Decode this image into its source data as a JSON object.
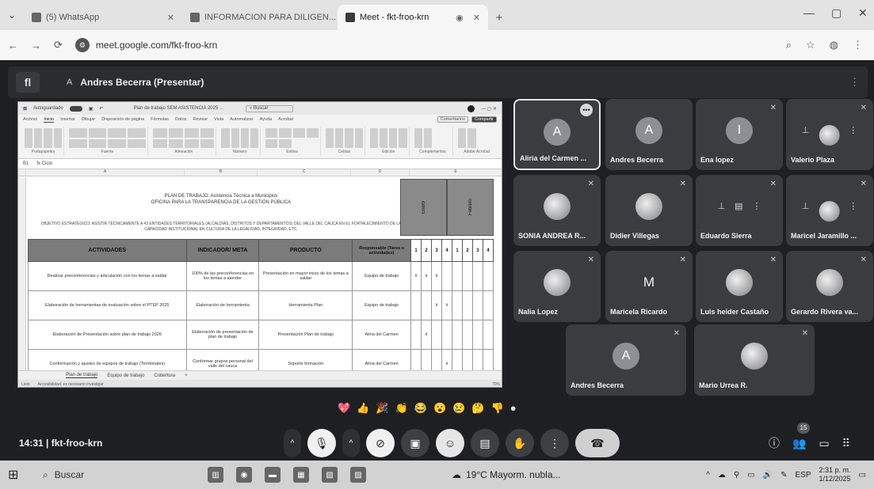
{
  "browser": {
    "tabs": [
      {
        "title": "(5) WhatsApp",
        "active": false
      },
      {
        "title": "INFORMACION PARA DILIGEN...",
        "active": false
      },
      {
        "title": "Meet - fkt-froo-krn",
        "active": true
      }
    ],
    "url": "meet.google.com/fkt-froo-krn",
    "window_controls": [
      "—",
      "▢",
      "✕"
    ]
  },
  "meet": {
    "logo_letter": "fl",
    "presenter_initial": "A",
    "presenter_label": "Andres Becerra (Presentar)",
    "meeting_code": "14:31  |  fkt-froo-krn",
    "participant_count": "15",
    "participants": [
      {
        "name": "Aliria del Carmen ...",
        "initial": "A"
      },
      {
        "name": "Andres Becerra",
        "initial": "A"
      },
      {
        "name": "Ena lopez",
        "initial": "I"
      },
      {
        "name": "Valerio Plaza",
        "initial": ""
      },
      {
        "name": "SONIA ANDREA R...",
        "initial": ""
      },
      {
        "name": "Didier Villegas",
        "initial": ""
      },
      {
        "name": "Eduardo Sierra",
        "initial": ""
      },
      {
        "name": "Maricel Jaramillo ...",
        "initial": ""
      },
      {
        "name": "Nalia Lopez",
        "initial": ""
      },
      {
        "name": "Maricela Ricardo",
        "initial": "M"
      },
      {
        "name": "Luis heider Castaño",
        "initial": ""
      },
      {
        "name": "Gerardo Rivera va...",
        "initial": ""
      },
      {
        "name": "Andres Becerra",
        "initial": "A"
      },
      {
        "name": "Mario Urrea R.",
        "initial": ""
      }
    ],
    "reactions": [
      "💖",
      "👍",
      "🎉",
      "👏",
      "😂",
      "😮",
      "😢",
      "🤔",
      "👎",
      "●"
    ]
  },
  "excel": {
    "autosave": "Autoguardado",
    "file_title": "Plan de trabajo SEM ASISTENCIA 2025 ...",
    "search": "Buscar",
    "menu": [
      "Archivo",
      "Inicio",
      "Insertar",
      "Dibujar",
      "Disposición de página",
      "Fórmulas",
      "Datos",
      "Revisar",
      "Vista",
      "Automatizar",
      "Ayuda",
      "Acrobat"
    ],
    "comments_btn": "Comentarios",
    "share_btn": "Compartir",
    "ribbon_groups": [
      "Portapapeles",
      "Fuente",
      "Alineación",
      "Número",
      "Estilos",
      "Celdas",
      "Edición",
      "Complementos",
      "Adobe Acrobat"
    ],
    "cell_ref": "B1",
    "formula": "fx  Ciclo",
    "columns": [
      "A",
      "B",
      "C",
      "D",
      "E"
    ],
    "plan_title": "PLAN DE TRABAJO: Asistencia Técnica a Municipios",
    "plan_subtitle": "OFICINA PARA LA TRANSPARENCIA DE LA GESTIÓN PÚBLICA",
    "objective": "OBJETIVO ESTRATÉGICO: ASISTIR TÉCNICAMENTE A 43 ENTIDADES TERRITORIALES (ALCALDÍAS, DISTRITOS Y DEPARTAMENTOS) DEL VALLE DEL CAUCA EN EL FORTALECIMIENTO DE LA CAPACIDAD INSTITUCIONAL EN CULTURA DE LA LEGALIDAD, INTEGRIDAD, ETC.",
    "quarter_labels": [
      "Enero",
      "Febrero"
    ],
    "table_headers": [
      "ACTIVIDADES",
      "INDICADOR/ META",
      "PRODUCTO",
      "Responsable (Tarea o actividades)"
    ],
    "week_numbers": [
      "1",
      "2",
      "3",
      "4",
      "1",
      "2",
      "3",
      "4"
    ],
    "rows": [
      {
        "actividad": "Realizar preconferencias y articulación con los temas a saldar",
        "indicador": "100% de las preconferencias en los temas a atender",
        "producto": "Presentación en mayor inicio de los temas a saldar",
        "responsable": "Equipo de trabajo",
        "marks": [
          "x",
          "x",
          "x",
          "",
          "",
          "",
          "",
          ""
        ]
      },
      {
        "actividad": "Elaboración de herramientas de evaluación sobre el PTEP 2025",
        "indicador": "Elaboración de herramienta",
        "producto": "Herramienta Plan",
        "responsable": "Equipo de trabajo",
        "marks": [
          "",
          "",
          "x",
          "x",
          "",
          "",
          "",
          ""
        ]
      },
      {
        "actividad": "Elaboración de Presentación sobre plan de trabajo 2026",
        "indicador": "Elaboración de presentación de plan de trabajo",
        "producto": "Presentación Plan de trabajo",
        "responsable": "Aliria del Carmen",
        "marks": [
          "",
          "x",
          "",
          "",
          "",
          "",
          "",
          ""
        ]
      },
      {
        "actividad": "Conformación y ajustes de equipos de trabajo (Territoriales)",
        "indicador": "Conformar grupos personal del valle del cauca",
        "producto": "Soporte formación",
        "responsable": "Aliria del Carmen",
        "marks": [
          "",
          "",
          "",
          "x",
          "",
          "",
          "",
          ""
        ]
      }
    ],
    "sheet_tabs": [
      "Plan de trabajo",
      "Equipo de trabajo",
      "Cobertura"
    ],
    "status_left": "Listo",
    "status_accessibility": "Accesibilidad: es necesario investigar",
    "zoom": "70%"
  },
  "taskbar": {
    "search": "Buscar",
    "weather": "19°C  Mayorm. nubla...",
    "lang": "ESP",
    "time": "2:31 p. m.",
    "date": "1/12/2025"
  }
}
